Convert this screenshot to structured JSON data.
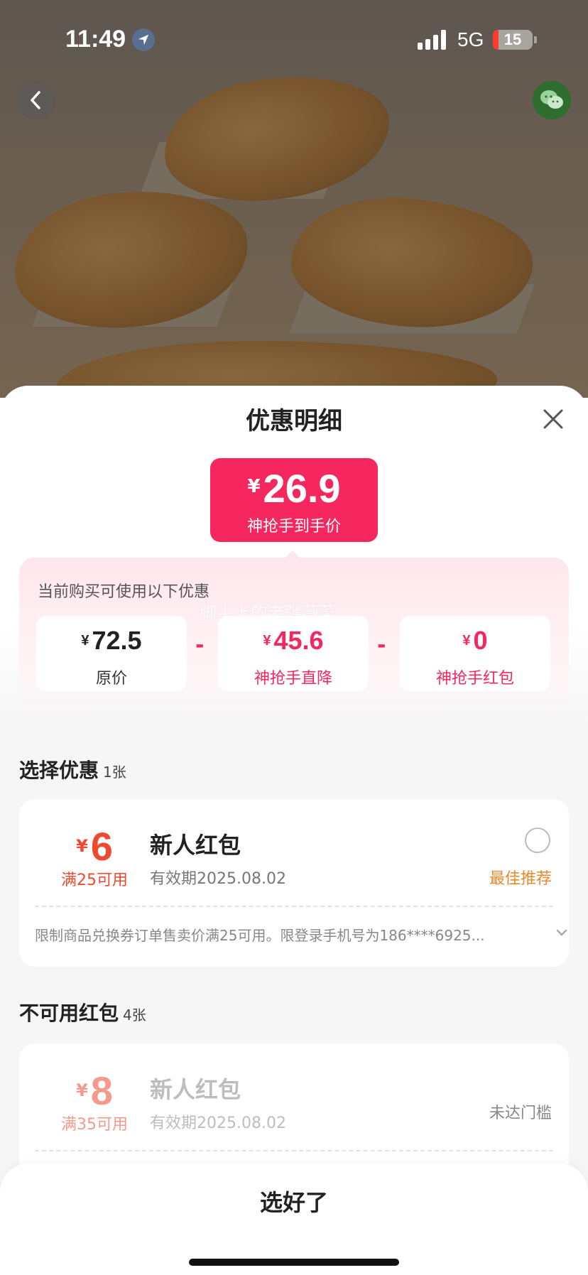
{
  "status_bar": {
    "time": "11:49",
    "network": "5G",
    "battery": "15",
    "icons": [
      "location-arrow-icon",
      "signal-icon",
      "battery-icon"
    ]
  },
  "header": {
    "back_icon": "chevron-left-icon",
    "share_icon": "wechat-icon"
  },
  "sheet": {
    "title": "优惠明细",
    "close_icon": "close-icon",
    "final_price": {
      "currency": "¥",
      "value": "26.9",
      "label": "神抢手到手价"
    },
    "breakdown": {
      "label": "当前购买可使用以下优惠",
      "watermark": "脚尖上的老疆薇菜",
      "operator": "-",
      "items": [
        {
          "currency": "¥",
          "value": "72.5",
          "label": "原价"
        },
        {
          "currency": "¥",
          "value": "45.6",
          "label": "神抢手直降"
        },
        {
          "currency": "¥",
          "value": "0",
          "label": "神抢手红包"
        }
      ]
    },
    "select_section": {
      "title": "选择优惠",
      "count": "1张",
      "coupons": [
        {
          "currency": "¥",
          "amount": "6",
          "condition": "满25可用",
          "name": "新人红包",
          "validity": "有效期2025.08.02",
          "tag": "最佳推荐",
          "description": "限制商品兑换券订单售卖价满25可用。限登录手机号为186****6925...",
          "selected": false
        }
      ]
    },
    "unavailable_section": {
      "title": "不可用红包",
      "count": "4张",
      "coupons": [
        {
          "currency": "¥",
          "amount": "8",
          "condition": "满35可用",
          "name": "新人红包",
          "validity": "有效期2025.08.02",
          "status": "未达门槛"
        }
      ]
    },
    "confirm_label": "选好了"
  },
  "colors": {
    "accent_pink": "#f5275e",
    "coupon_red": "#f04a2e",
    "recommend_orange": "#e8892b"
  }
}
